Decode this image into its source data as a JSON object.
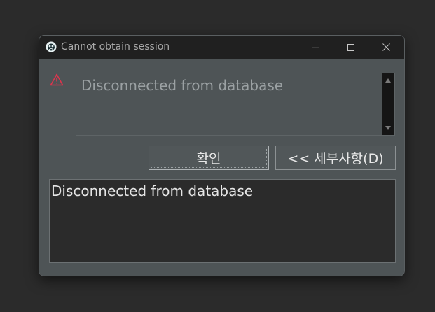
{
  "window": {
    "title": "Cannot obtain session",
    "icon": "app-logo-icon"
  },
  "controls": {
    "minimize_icon": "minimize-icon",
    "maximize_icon": "maximize-icon",
    "close_icon": "close-icon"
  },
  "message": {
    "icon": "warning-icon",
    "text": "Disconnected from database"
  },
  "buttons": {
    "ok_label": "확인",
    "details_label": "<< 세부사항(D)"
  },
  "details": {
    "text": "Disconnected from database"
  },
  "colors": {
    "titlebar": "#202020",
    "content_bg": "#4e5456",
    "details_bg": "#2b2b2b",
    "warning": "#e0334c"
  }
}
